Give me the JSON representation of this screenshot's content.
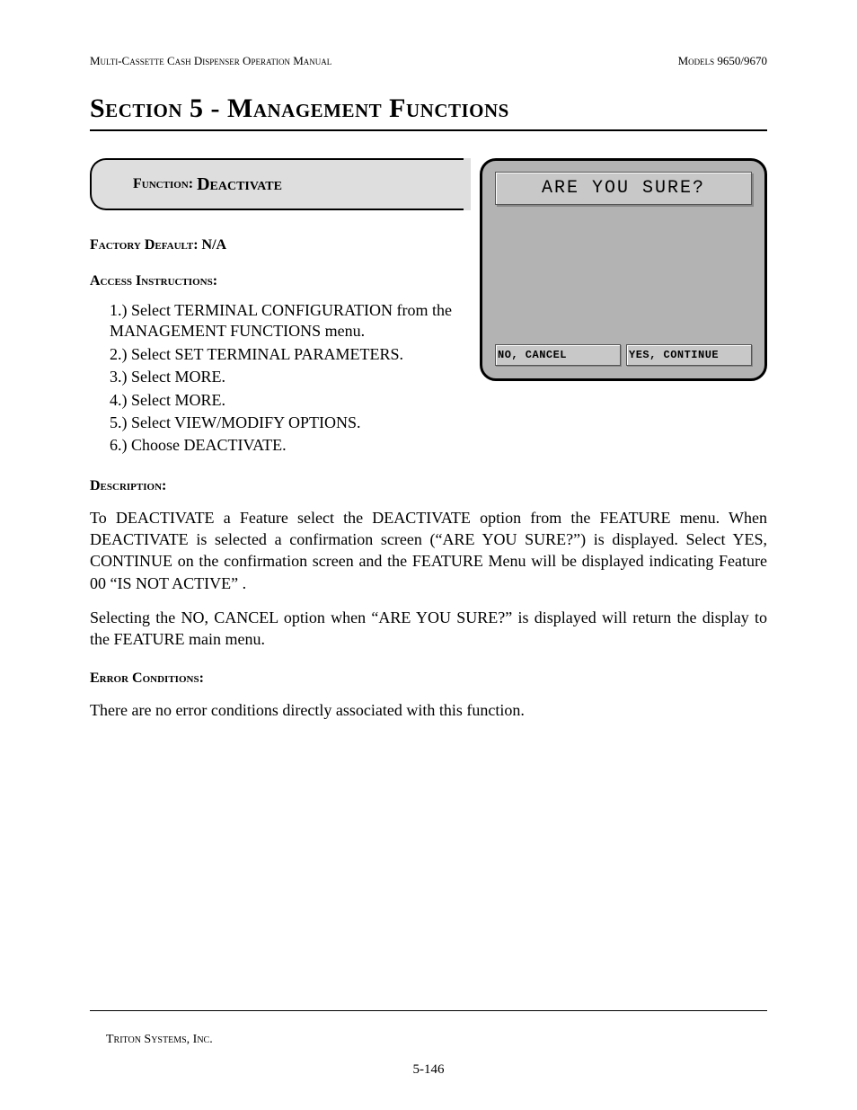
{
  "header": {
    "left": "Multi-Cassette Cash Dispenser Operation Manual",
    "right": "Models 9650/9670"
  },
  "section_title": "Section 5 - Management Functions",
  "function_box": {
    "label": "Function:",
    "name": "Deactivate"
  },
  "factory_default": {
    "label": "Factory Default:",
    "value": "N/A"
  },
  "access": {
    "heading": "Access Instructions:",
    "steps": [
      "Select TERMINAL CONFIGURATION from the MANAGEMENT FUNCTIONS menu.",
      "Select SET TERMINAL PARAMETERS.",
      "Select MORE.",
      "Select MORE.",
      "Select VIEW/MODIFY OPTIONS.",
      "Choose DEACTIVATE."
    ]
  },
  "screen": {
    "title": "ARE YOU SURE?",
    "btn_no": "NO, CANCEL",
    "btn_yes": "YES, CONTINUE"
  },
  "description": {
    "heading": "Description:",
    "p1": "To DEACTIVATE a Feature select the DEACTIVATE option from the FEATURE  menu.  When DEACTIVATE is selected a confirmation screen (“ARE YOU SURE?”) is displayed.  Select YES, CONTINUE  on the confirmation screen and the FEATURE  Menu will be displayed indicating Feature 00 “IS NOT ACTIVE” .",
    "p2": "Selecting the NO, CANCEL option when “ARE YOU SURE?” is displayed will return the display to the FEATURE  main  menu."
  },
  "errors": {
    "heading": "Error Conditions:",
    "text": "There are no error conditions directly associated with this function."
  },
  "footer": {
    "company": "Triton Systems, Inc.",
    "page": "5-146"
  }
}
